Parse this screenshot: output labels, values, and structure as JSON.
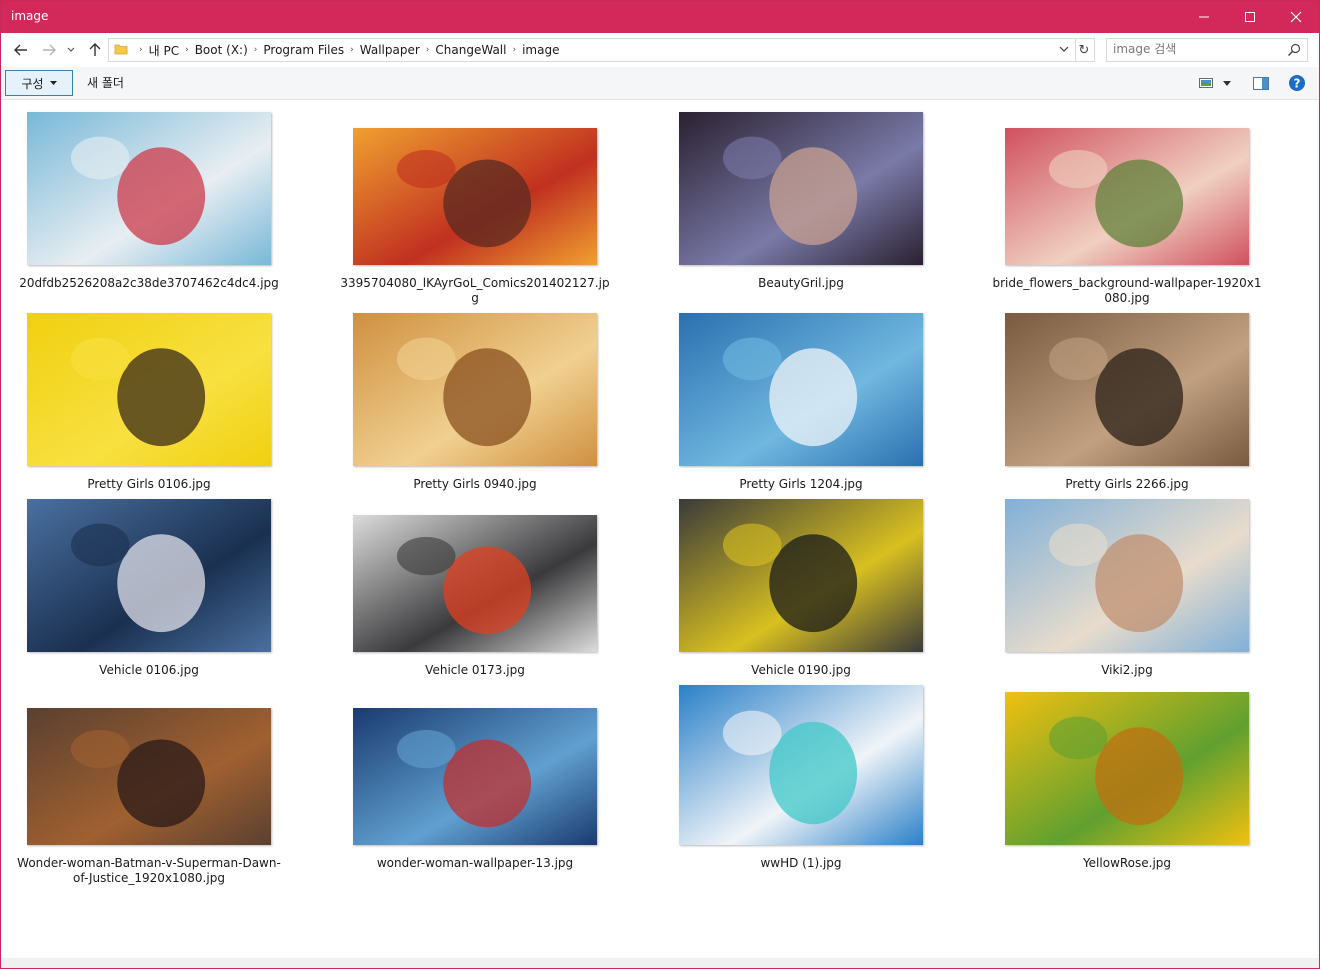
{
  "window": {
    "title": "image",
    "accent": "#d2285a"
  },
  "title_buttons": {
    "minimize": "minimize-icon",
    "maximize": "maximize-icon",
    "close": "close-icon"
  },
  "address": {
    "crumbs": [
      "내 PC",
      "Boot (X:)",
      "Program Files",
      "Wallpaper",
      "ChangeWall",
      "image"
    ]
  },
  "search": {
    "placeholder": "image 검색"
  },
  "toolbar": {
    "organize_label": "구성",
    "new_folder_label": "새 폴더"
  },
  "files": [
    {
      "name": "20dfdb2526208a2c38de3707462c4dc4.jpg",
      "palette": [
        "#78b8d8",
        "#e8eef2",
        "#cc3a4a"
      ]
    },
    {
      "name": "3395704080_lKAyrGoL_Comics201402127.jpg",
      "palette": [
        "#f0a030",
        "#c03020",
        "#5a2a20"
      ]
    },
    {
      "name": "BeautyGril.jpg",
      "palette": [
        "#2a2030",
        "#7a7aa8",
        "#c8a090"
      ]
    },
    {
      "name": "bride_flowers_background-wallpaper-1920x1080.jpg",
      "palette": [
        "#d05060",
        "#f0d0c0",
        "#60803a"
      ]
    },
    {
      "name": "Pretty Girls 0106.jpg",
      "palette": [
        "#f0d010",
        "#f8e040",
        "#3a2a1a"
      ]
    },
    {
      "name": "Pretty Girls 0940.jpg",
      "palette": [
        "#d09040",
        "#f0d090",
        "#8a5020"
      ]
    },
    {
      "name": "Pretty Girls 1204.jpg",
      "palette": [
        "#2a70b0",
        "#70b8e0",
        "#f0f4f8"
      ]
    },
    {
      "name": "Pretty Girls 2266.jpg",
      "palette": [
        "#7a5a40",
        "#c0a080",
        "#2a2018"
      ]
    },
    {
      "name": "Vehicle 0106.jpg",
      "palette": [
        "#4a70a0",
        "#1a3050",
        "#e0e0e8"
      ]
    },
    {
      "name": "Vehicle 0173.jpg",
      "palette": [
        "#dcdcdc",
        "#3a3a3c",
        "#e04020"
      ]
    },
    {
      "name": "Vehicle 0190.jpg",
      "palette": [
        "#3a3a3a",
        "#d8c020",
        "#1a1a1a"
      ]
    },
    {
      "name": "Viki2.jpg",
      "palette": [
        "#80b0d8",
        "#e8dccc",
        "#c09070"
      ]
    },
    {
      "name": "Wonder-woman-Batman-v-Superman-Dawn-of-Justice_1920x1080.jpg",
      "palette": [
        "#5a4030",
        "#a06030",
        "#2a1a18"
      ]
    },
    {
      "name": "wonder-woman-wallpaper-13.jpg",
      "palette": [
        "#1a3a70",
        "#60a0d0",
        "#c03030"
      ]
    },
    {
      "name": "wwHD  (1).jpg",
      "palette": [
        "#2a80c8",
        "#f0f4f8",
        "#40c8c8"
      ]
    },
    {
      "name": "YellowRose.jpg",
      "palette": [
        "#f0c010",
        "#60a030",
        "#c07010"
      ]
    }
  ]
}
